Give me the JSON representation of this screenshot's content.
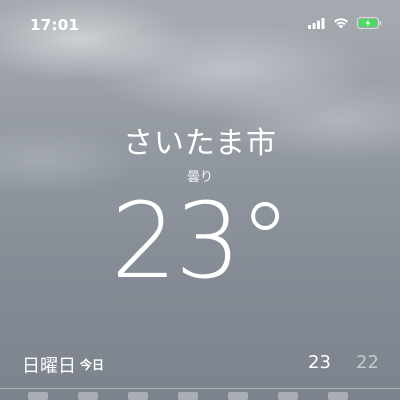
{
  "status_bar": {
    "time": "17:01",
    "icons": [
      "cellular-signal-icon",
      "wifi-icon",
      "battery-charging-icon"
    ],
    "battery_color": "#4cd964"
  },
  "weather": {
    "city": "さいたま市",
    "condition": "曇り",
    "temperature": "23°"
  },
  "today": {
    "day": "日曜日",
    "label": "今日",
    "high": "23",
    "low": "22"
  },
  "colors": {
    "sky_top": "#a7abb1",
    "sky_bottom": "#7c838d",
    "text": "#ffffff"
  }
}
